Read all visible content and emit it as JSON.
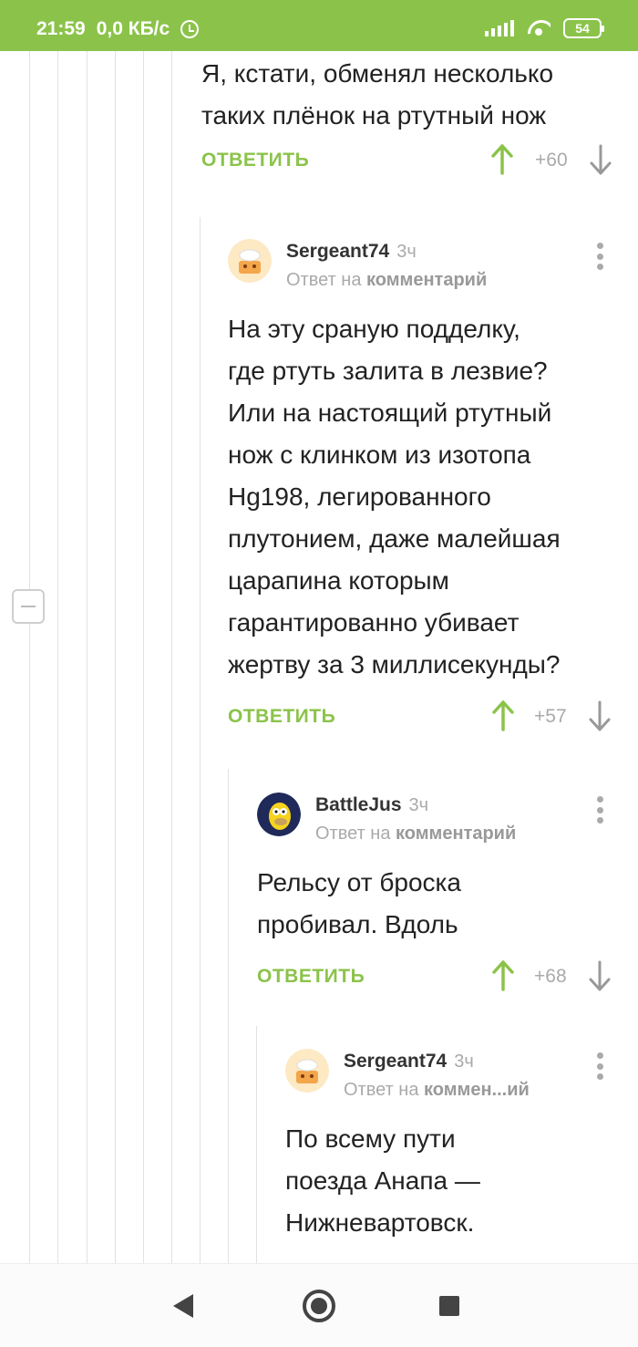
{
  "status_bar": {
    "time": "21:59",
    "net_speed": "0,0 КБ/с",
    "battery": "54"
  },
  "comments": [
    {
      "body_lines": [
        "Я, кстати, обменял несколько",
        "таких плёнок на ртутный нож"
      ],
      "reply_label": "ОТВЕТИТЬ",
      "score": "+60"
    },
    {
      "author": "Sergeant74",
      "time": "3ч",
      "reply_prefix": "Ответ на",
      "reply_target": "комментарий",
      "body_lines": [
        "На эту сраную подделку,",
        "где ртуть залита в лезвие?",
        "Или на настоящий ртутный",
        "нож с клинком из изотопа",
        "Hg198, легированного",
        "плутонием, даже малейшая",
        "царапина которым",
        "гарантированно убивает",
        "жертву за 3 миллисекунды?"
      ],
      "reply_label": "ОТВЕТИТЬ",
      "score": "+57"
    },
    {
      "author": "BattleJus",
      "time": "3ч",
      "reply_prefix": "Ответ на",
      "reply_target": "комментарий",
      "body_lines": [
        "Рельсу от броска",
        "пробивал. Вдоль"
      ],
      "reply_label": "ОТВЕТИТЬ",
      "score": "+68"
    },
    {
      "author": "Sergeant74",
      "time": "3ч",
      "reply_prefix": "Ответ на",
      "reply_target": "коммен...ий",
      "body_lines": [
        "По всему пути",
        "поезда Анапа —",
        "Нижневартовск."
      ]
    }
  ],
  "colors": {
    "accent": "#8bc34a",
    "muted": "#aaaaaa",
    "thread_line": "#e2e2e2"
  },
  "icons": {
    "upvote": "arrow-up-icon",
    "downvote": "arrow-down-icon",
    "menu": "vertical-dots-icon",
    "collapse": "minus-icon"
  }
}
